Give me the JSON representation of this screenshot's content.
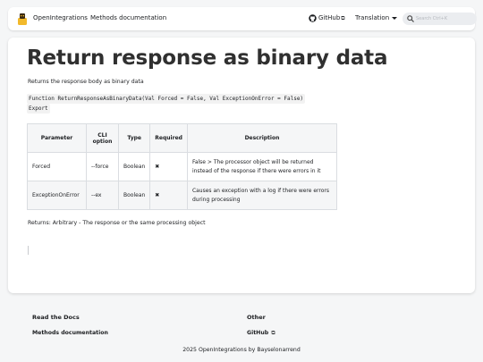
{
  "navbar": {
    "brand": "OpenIntegrations",
    "docs_link": "Methods documentation",
    "github_label": "GitHub",
    "translation_label": "Translation",
    "search_placeholder": "Search Ctrl+K"
  },
  "page": {
    "title": "Return response as binary data",
    "subtitle": "Returns the response body as binary data",
    "code_line1": "Function ReturnResponseAsBinaryData(Val Forced = False, Val ExceptionOnError = False)",
    "code_line2": "Export",
    "table": {
      "headers": [
        "Parameter",
        "CLI option",
        "Type",
        "Required",
        "Description"
      ],
      "rows": [
        {
          "parameter": "Forced",
          "cli": "--force",
          "type": "Boolean",
          "required": "✖",
          "description": "False > The processor object will be returned instead of the response if there were errors in it"
        },
        {
          "parameter": "ExceptionOnError",
          "cli": "--ex",
          "type": "Boolean",
          "required": "✖",
          "description": "Causes an exception with a log if there were errors during processing"
        }
      ]
    },
    "returns": "Returns: Arbitrary - The response or the same processing object"
  },
  "footer": {
    "col1_title": "Read the Docs",
    "col1_link": "Methods documentation",
    "col2_title": "Other",
    "col2_link": "GitHub",
    "copyright": "2025 OpenIntegrations by Bayselonarrend"
  },
  "colors": {
    "background": "#f5f6f7",
    "card": "#ffffff",
    "search_bg": "#ebedf0",
    "table_border": "#dadde1",
    "logo_yellow": "#f2b92b"
  },
  "icons": {
    "logo": "logo-icon",
    "github": "github-icon",
    "external": "external-link-icon",
    "search": "search-icon",
    "dropdown": "chevron-down-icon"
  }
}
